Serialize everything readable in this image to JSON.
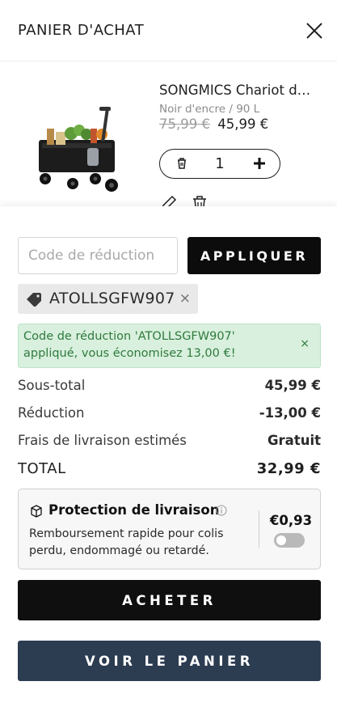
{
  "header": {
    "title": "PANIER D'ACHAT",
    "close_icon": "close-icon"
  },
  "item": {
    "title": "SONGMICS Chariot de transport pliable",
    "variant": "Noir d'encre / 90 L",
    "price_old": "75,99 €",
    "price_new": "45,99 €",
    "quantity": "1",
    "icons": [
      "trash-icon",
      "plus-icon",
      "edit-icon",
      "trash-icon"
    ]
  },
  "discount": {
    "placeholder": "Code de réduction",
    "apply_label": "APPLIQUER",
    "applied_code": "ATOLLSGFW907",
    "remove_label": "×",
    "success_message": "Code de réduction 'ATOLLSGFW907' appliqué, vous économisez 13,00 €!",
    "success_close": "×",
    "success_color": "#d8f0dd"
  },
  "summary": {
    "subtotal_label": "Sous-total",
    "subtotal_value": "45,99 €",
    "discount_label": "Réduction",
    "discount_value": "-13,00 €",
    "shipping_label": "Frais de livraison estimés",
    "shipping_value": "Gratuit",
    "total_label": "TOTAL",
    "total_value": "32,99 €"
  },
  "protection": {
    "title": "Protection de livraison",
    "description": "Remboursement rapide pour colis perdu, endommagé ou retardé.",
    "price": "€0,93",
    "enabled": false
  },
  "actions": {
    "buy_label": "ACHETER",
    "view_cart_label": "VOIR LE PANIER",
    "cart_button_color": "#2c3c51"
  }
}
